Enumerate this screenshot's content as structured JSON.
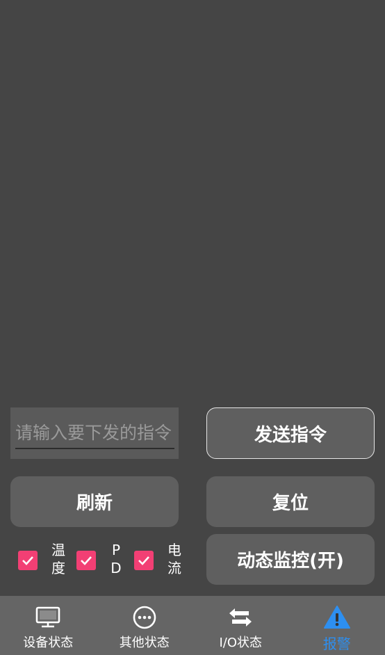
{
  "command": {
    "placeholder": "请输入要下发的指令",
    "value": "",
    "send_label": "发送指令"
  },
  "actions": {
    "refresh_label": "刷新",
    "reset_label": "复位",
    "monitor_label": "动态监控(开)"
  },
  "checks": [
    {
      "label": "温度",
      "checked": true
    },
    {
      "label": "PD",
      "checked": true
    },
    {
      "label": "电流",
      "checked": true
    }
  ],
  "nav": {
    "items": [
      {
        "label": "设备状态",
        "icon": "monitor-icon",
        "active": false
      },
      {
        "label": "其他状态",
        "icon": "more-icon",
        "active": false
      },
      {
        "label": "I/O状态",
        "icon": "swap-icon",
        "active": false
      },
      {
        "label": "报警",
        "icon": "alert-icon",
        "active": true
      }
    ]
  },
  "colors": {
    "background": "#454545",
    "button": "#5f5f5f",
    "checkbox": "#f23f74",
    "nav_background": "#656565",
    "nav_active": "#2d8ff0"
  }
}
